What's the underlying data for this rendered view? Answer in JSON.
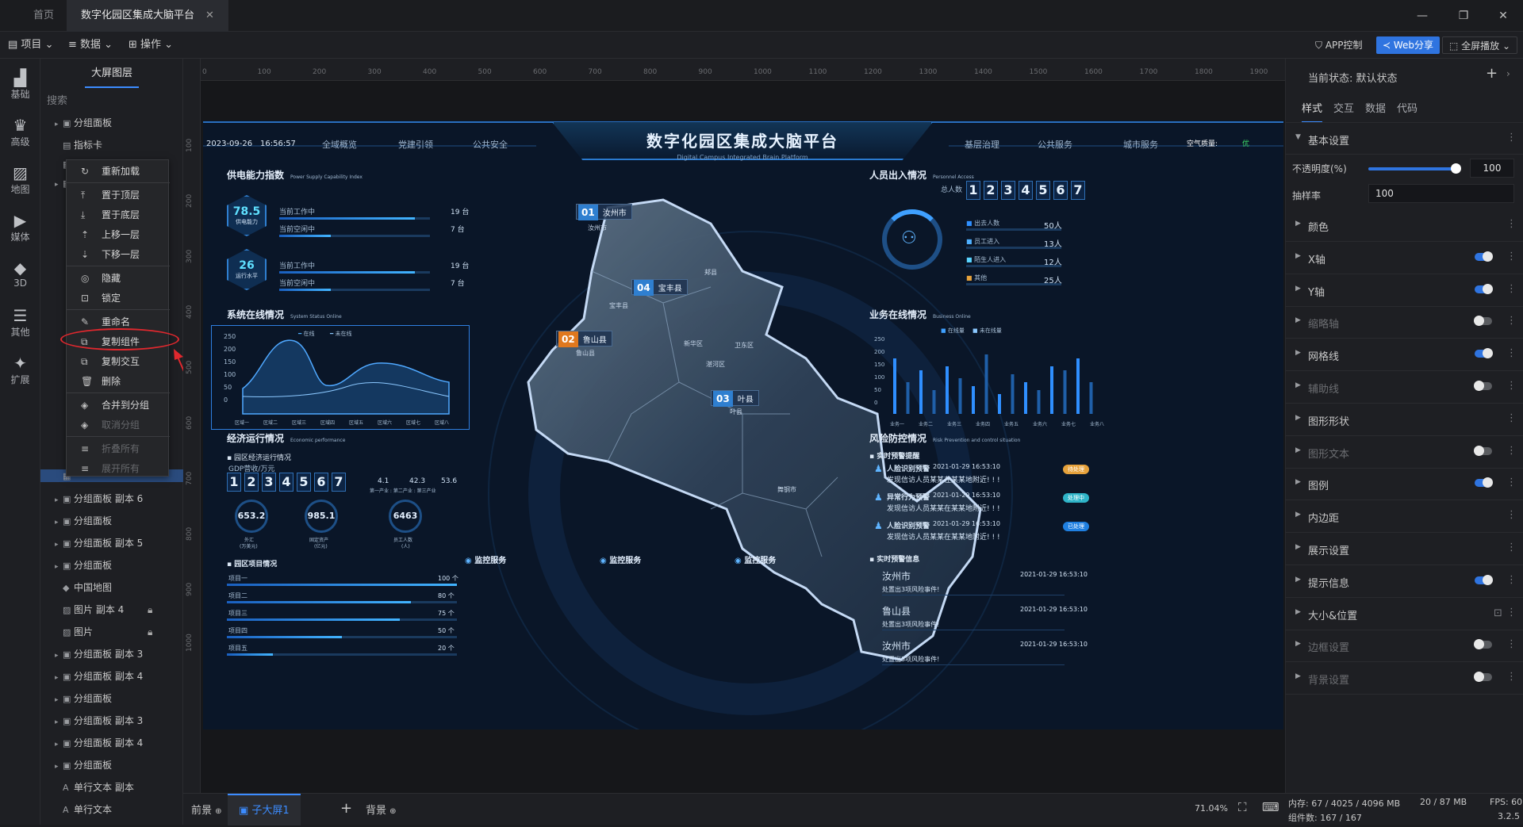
{
  "titlebar": {
    "tabs": [
      "首页",
      "数字化园区集成大脑平台"
    ],
    "close": "✕",
    "win": [
      "—",
      "❐",
      "✕"
    ]
  },
  "menubar": {
    "items": [
      "项目",
      "数据",
      "操作"
    ],
    "right": [
      "APP控制",
      "Web分享",
      "全屏播放"
    ]
  },
  "leftbar": [
    "基础",
    "高级",
    "地图",
    "媒体",
    "3D",
    "其他",
    "扩展"
  ],
  "layers": {
    "title": "大屏图层",
    "search": "搜索",
    "items": [
      "分组面板",
      "指标卡",
      "分组面板 副本 6",
      "分组面板",
      "分组面板 副本 5",
      "分组面板",
      "中国地图",
      "图片 副本 4",
      "图片",
      "分组面板 副本 3",
      "分组面板 副本 4",
      "分组面板",
      "分组面板 副本 3",
      "分组面板 副本 4",
      "分组面板",
      "单行文本 副本",
      "单行文本"
    ]
  },
  "context_menu": [
    "重新加载",
    "置于顶层",
    "置于底层",
    "上移一层",
    "下移一层",
    "隐藏",
    "锁定",
    "重命名",
    "复制组件",
    "复制交互",
    "删除",
    "合并到分组",
    "取消分组",
    "折叠所有",
    "展开所有"
  ],
  "ruler": {
    "h": [
      "0",
      "100",
      "200",
      "300",
      "400",
      "500",
      "600",
      "700",
      "800",
      "900",
      "1000",
      "1100",
      "1200",
      "1300",
      "1400",
      "1500",
      "1600",
      "1700",
      "1800",
      "1900"
    ],
    "v": [
      "100",
      "200",
      "300",
      "400",
      "500",
      "600",
      "700",
      "800",
      "900",
      "1000"
    ]
  },
  "dashboard": {
    "date": "2023-09-26",
    "time": "16:56:57",
    "title": "数字化园区集成大脑平台",
    "subtitle": "Digital Campus Integrated Brain Platform",
    "nav_left": [
      "全域概览",
      "党建引领",
      "公共安全"
    ],
    "nav_right": [
      "基层治理",
      "公共服务",
      "城市服务"
    ],
    "air": "空气质量:",
    "air_val": "优",
    "power": {
      "title": "供电能力指数",
      "en": "Power Supply Capability Index",
      "hex1": "78.5",
      "hex1_label": "供电能力",
      "hex2": "26",
      "hex2_label": "运行水平",
      "rows": [
        "当前工作中",
        "当前空闲中",
        "当前工作中",
        "当前空闲中"
      ],
      "vals": [
        "19 台",
        "7 台",
        "19 台",
        "7 台"
      ]
    },
    "system": {
      "title": "系统在线情况",
      "en": "System Status Online",
      "legend": [
        "在线",
        "未在线"
      ],
      "yticks": [
        "250",
        "200",
        "150",
        "100",
        "50",
        "0"
      ],
      "xticks": [
        "区域一",
        "区域二",
        "区域三",
        "区域四",
        "区域五",
        "区域六",
        "区域七",
        "区域八"
      ]
    },
    "economy": {
      "title": "经济运行情况",
      "en": "Economic performance",
      "sub": "园区经济运行情况",
      "gdp": "GDP营收/万元",
      "digits": [
        "1",
        "2",
        "3",
        "4",
        "5",
        "6",
        "7"
      ],
      "ratios": [
        "4.1",
        "42.3",
        "53.6"
      ],
      "ratio_label": "第一产业 : 第二产业 : 第三产业",
      "rings": [
        "653.2",
        "985.1",
        "6463"
      ],
      "ring_labels": [
        "外汇",
        "固定资产",
        "员工人数"
      ],
      "ring_units": [
        "(万美元)",
        "(亿元)",
        "(人)"
      ]
    },
    "projects": {
      "title": "园区项目情况",
      "names": [
        "项目一",
        "项目二",
        "项目三",
        "项目四",
        "项目五"
      ],
      "vals": [
        "100 个",
        "80 个",
        "75 个",
        "50 个",
        "20 个"
      ],
      "pct": [
        100,
        80,
        75,
        50,
        20
      ]
    },
    "personnel": {
      "title": "人员出入情况",
      "en": "Personnel Access",
      "total_label": "总人数",
      "digits": [
        "1",
        "2",
        "3",
        "4",
        "5",
        "6",
        "7"
      ],
      "rows": [
        "出去人数",
        "员工进入",
        "陌生人进入",
        "其他"
      ],
      "vals": [
        "50人",
        "13人",
        "12人",
        "25人"
      ],
      "colors": [
        "#2f8fff",
        "#4fb0ff",
        "#5ad4ff",
        "#e6a23c"
      ]
    },
    "business": {
      "title": "业务在线情况",
      "en": "Business Online",
      "legend": [
        "在线量",
        "未在线量"
      ],
      "yticks": [
        "250",
        "200",
        "150",
        "100",
        "50",
        "0"
      ],
      "xticks": [
        "业务一",
        "业务二",
        "业务三",
        "业务四",
        "业务五",
        "业务六",
        "业务七",
        "业务八"
      ]
    },
    "risk": {
      "title": "风险防控情况",
      "en": "Risk Prevention and control situation",
      "sub1": "实时预警提醒",
      "alerts": [
        {
          "type": "人脸识别预警",
          "time": "2021-01-29 16:53:10",
          "msg": "发现信访人员某某在某某地附近! ! !",
          "tag": "待处理",
          "tagc": "#e6a23c"
        },
        {
          "type": "异常行为预警",
          "time": "2021-01-29 16:53:10",
          "msg": "发现信访人员某某在某某地附近! ! !",
          "tag": "处理中",
          "tagc": "#2fb4c8"
        },
        {
          "type": "人脸识别预警",
          "time": "2021-01-29 16:53:10",
          "msg": "发现信访人员某某在某某地附近! ! !",
          "tag": "已处理",
          "tagc": "#1f7fe0"
        }
      ],
      "sub2": "实时预警信息",
      "infos": [
        {
          "place": "汝州市",
          "time": "2021-01-29 16:53:10",
          "msg": "处置出3项风险事件!"
        },
        {
          "place": "鲁山县",
          "time": "2021-01-29 16:53:10",
          "msg": "处置出3项风险事件!"
        },
        {
          "place": "汝州市",
          "time": "2021-01-29 16:53:10",
          "msg": "处置出3项风险事件!"
        }
      ]
    },
    "map": {
      "badges": [
        {
          "n": "01",
          "name": "汝州市",
          "c": "#2f7fd0"
        },
        {
          "n": "04",
          "name": "宝丰县",
          "c": "#2f7fd0"
        },
        {
          "n": "02",
          "name": "鲁山县",
          "c": "#e0781e"
        },
        {
          "n": "03",
          "name": "叶县",
          "c": "#2f7fd0"
        }
      ],
      "labels": [
        "汝州市",
        "郏县",
        "宝丰县",
        "鲁山县",
        "新华区",
        "卫东区",
        "湛河区",
        "叶县",
        "舞钢市"
      ]
    },
    "monitor": [
      "监控服务",
      "监控服务",
      "监控服务"
    ]
  },
  "right_panel": {
    "state": "当前状态: 默认状态",
    "tabs": [
      "样式",
      "交互",
      "数据",
      "代码"
    ],
    "basic": "基本设置",
    "opacity_label": "不透明度(%)",
    "opacity": "100",
    "opacity_level": 1.0,
    "sample_label": "抽样率",
    "sample": "100",
    "rows": [
      {
        "label": "颜色",
        "toggle": "none",
        "dim": false
      },
      {
        "label": "X轴",
        "toggle": "on",
        "dim": false
      },
      {
        "label": "Y轴",
        "toggle": "on",
        "dim": false
      },
      {
        "label": "缩略轴",
        "toggle": "off",
        "dim": true
      },
      {
        "label": "网格线",
        "toggle": "on",
        "dim": false
      },
      {
        "label": "辅助线",
        "toggle": "off",
        "dim": true
      },
      {
        "label": "图形形状",
        "toggle": "none",
        "dim": false
      },
      {
        "label": "图形文本",
        "toggle": "off",
        "dim": true
      },
      {
        "label": "图例",
        "toggle": "on",
        "dim": false
      },
      {
        "label": "内边距",
        "toggle": "none",
        "dim": false
      },
      {
        "label": "展示设置",
        "toggle": "none",
        "dim": false
      },
      {
        "label": "提示信息",
        "toggle": "on",
        "dim": false
      },
      {
        "label": "大小&位置",
        "toggle": "lock",
        "dim": false
      },
      {
        "label": "边框设置",
        "toggle": "off",
        "dim": true
      },
      {
        "label": "背景设置",
        "toggle": "off",
        "dim": true
      }
    ]
  },
  "statusbar": {
    "tabs": [
      "前景",
      "子大屏1",
      "背景"
    ],
    "add": "+",
    "zoom": "71.04%"
  },
  "sysinfo": {
    "mem": "内存: 67 / 4025 / 4096 MB",
    "mem2": "20 / 87 MB",
    "fps": "FPS: 60",
    "comp": "组件数: 167 / 167",
    "ver": "3.2.5"
  }
}
